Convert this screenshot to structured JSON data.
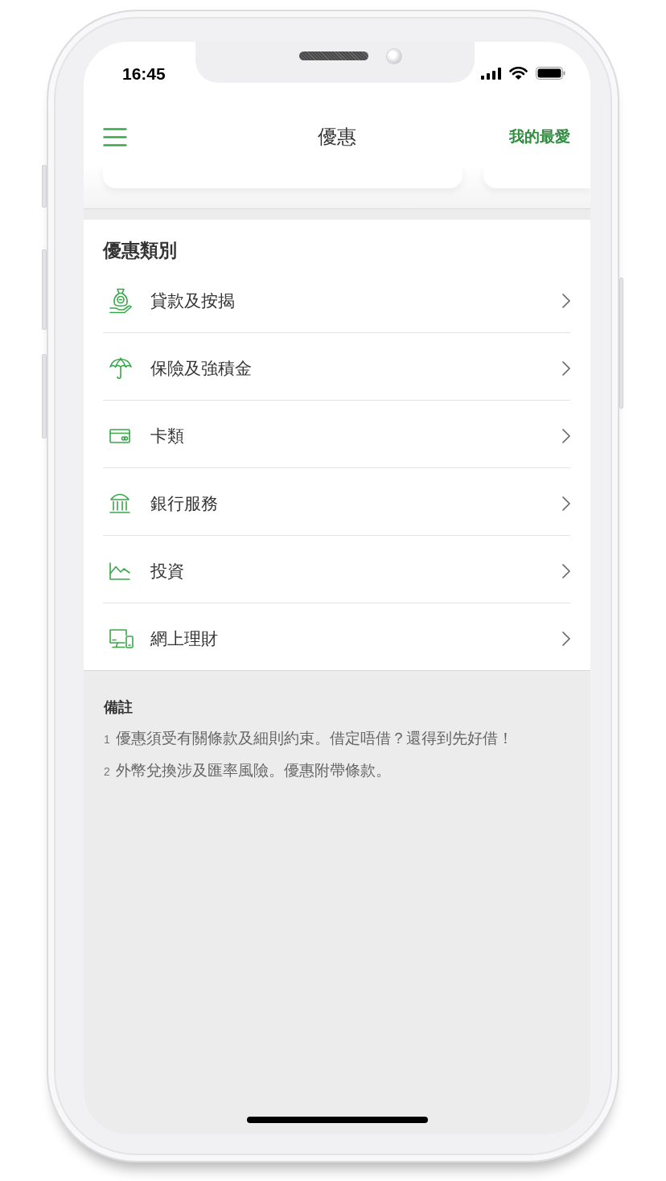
{
  "status_bar": {
    "time": "16:45"
  },
  "nav_bar": {
    "title": "優惠",
    "action": "我的最愛"
  },
  "categories": {
    "heading": "優惠類別",
    "items": [
      {
        "kind": "loan",
        "label": "貸款及按揭"
      },
      {
        "kind": "insurance",
        "label": "保險及強積金"
      },
      {
        "kind": "card",
        "label": "卡類"
      },
      {
        "kind": "bank",
        "label": "銀行服務"
      },
      {
        "kind": "investment",
        "label": "投資"
      },
      {
        "kind": "online",
        "label": "網上理財"
      }
    ]
  },
  "notes": {
    "heading": "備註",
    "items": [
      {
        "number": "1",
        "text": "優惠須受有關條款及細則約束。借定唔借？還得到先好借！"
      },
      {
        "number": "2",
        "text": "外幣兌換涉及匯率風險。優惠附帶條款。"
      }
    ]
  }
}
